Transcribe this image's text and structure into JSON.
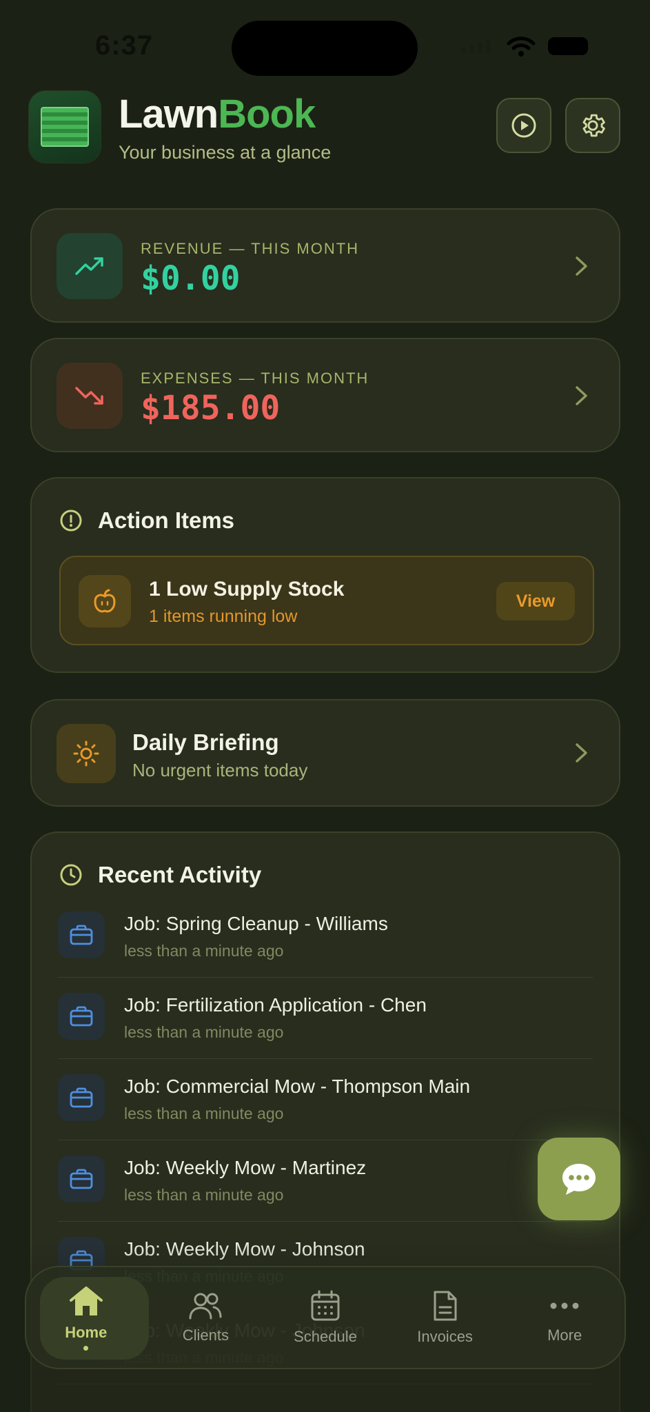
{
  "status_bar": {
    "time": "6:37"
  },
  "header": {
    "brand_part1": "Lawn",
    "brand_part2": "Book",
    "tagline": "Your business at a glance"
  },
  "revenue": {
    "label": "REVENUE — THIS MONTH",
    "value": "$0.00",
    "color": "#33d1a0"
  },
  "expenses": {
    "label": "EXPENSES — THIS MONTH",
    "value": "$185.00",
    "color": "#f0645c"
  },
  "action_items": {
    "title": "Action Items",
    "items": [
      {
        "title": "1 Low Supply Stock",
        "subtitle": "1 items running low",
        "button": "View"
      }
    ]
  },
  "daily_briefing": {
    "title": "Daily Briefing",
    "subtitle": "No urgent items today"
  },
  "recent_activity": {
    "title": "Recent Activity",
    "items": [
      {
        "title": "Job: Spring Cleanup - Williams",
        "time": "less than a minute ago"
      },
      {
        "title": "Job: Fertilization Application - Chen",
        "time": "less than a minute ago"
      },
      {
        "title": "Job: Commercial Mow - Thompson Main",
        "time": "less than a minute ago"
      },
      {
        "title": "Job: Weekly Mow - Martinez",
        "time": "less than a minute ago"
      },
      {
        "title": "Job: Weekly Mow - Johnson",
        "time": "less than a minute ago"
      },
      {
        "title": "Job: Weekly Mow - Johnson",
        "time": "less than a minute ago"
      }
    ]
  },
  "tabs": [
    {
      "label": "Home",
      "active": true
    },
    {
      "label": "Clients"
    },
    {
      "label": "Schedule"
    },
    {
      "label": "Invoices"
    },
    {
      "label": "More"
    }
  ]
}
